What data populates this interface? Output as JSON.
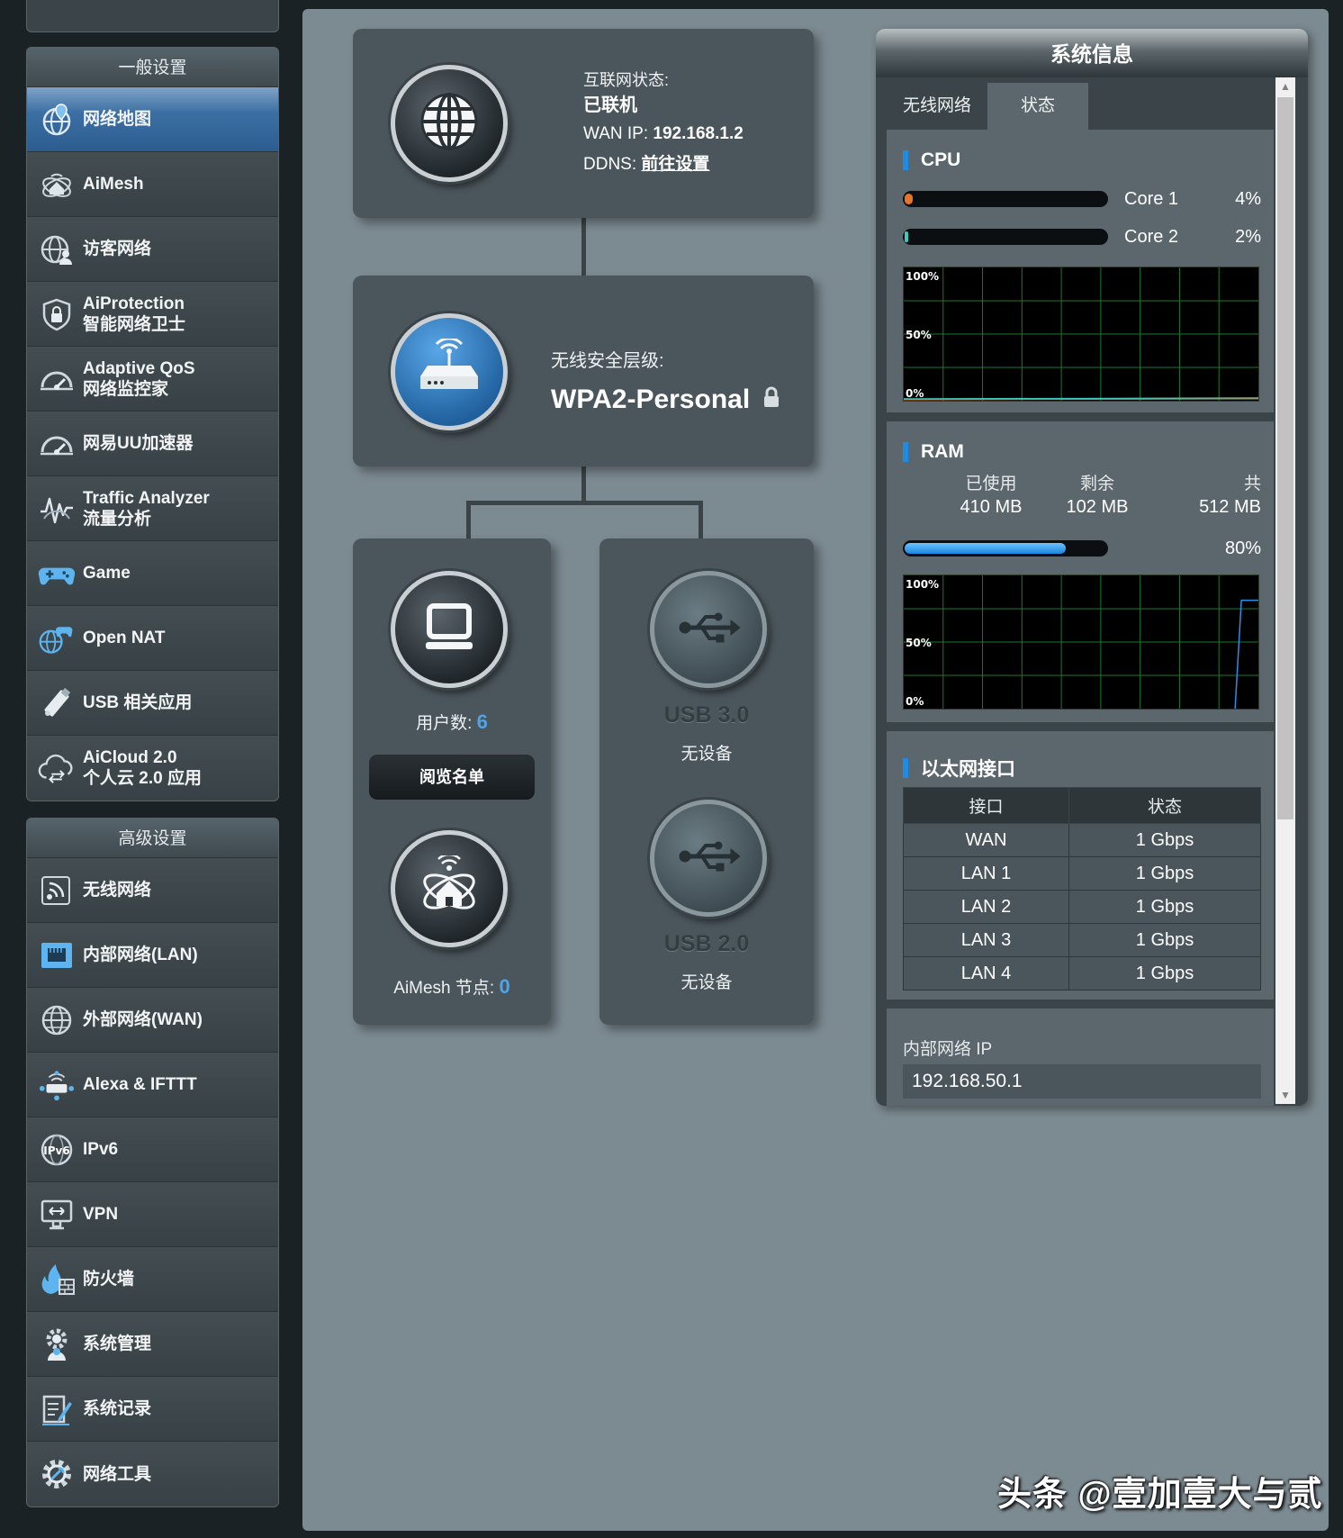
{
  "sidebar": {
    "general_header": "一般设置",
    "general_items": [
      {
        "label": "网络地图",
        "label2": "",
        "icon": "globe-map-icon",
        "active": true
      },
      {
        "label": "AiMesh",
        "label2": "",
        "icon": "aimesh-icon"
      },
      {
        "label": "访客网络",
        "label2": "",
        "icon": "guest-network-icon"
      },
      {
        "label": "AiProtection",
        "label2": "智能网络卫士",
        "icon": "shield-lock-icon"
      },
      {
        "label": "Adaptive QoS",
        "label2": "网络监控家",
        "icon": "speedometer-icon"
      },
      {
        "label": "网易UU加速器",
        "label2": "",
        "icon": "speedometer-icon"
      },
      {
        "label": "Traffic Analyzer",
        "label2": "流量分析",
        "icon": "traffic-wave-icon"
      },
      {
        "label": "Game",
        "label2": "",
        "icon": "gamepad-icon"
      },
      {
        "label": "Open NAT",
        "label2": "",
        "icon": "globe-gamepad-icon"
      },
      {
        "label": "USB 相关应用",
        "label2": "",
        "icon": "usb-pen-icon"
      },
      {
        "label": "AiCloud 2.0",
        "label2": "个人云 2.0 应用",
        "icon": "cloud-icon"
      }
    ],
    "advanced_header": "高级设置",
    "advanced_items": [
      {
        "label": "无线网络",
        "icon": "wireless-icon"
      },
      {
        "label": "内部网络(LAN)",
        "icon": "lan-port-icon"
      },
      {
        "label": "外部网络(WAN)",
        "icon": "globe-icon"
      },
      {
        "label": "Alexa & IFTTT",
        "icon": "alexa-router-icon"
      },
      {
        "label": "IPv6",
        "icon": "ipv6-icon"
      },
      {
        "label": "VPN",
        "icon": "vpn-monitor-icon"
      },
      {
        "label": "防火墙",
        "icon": "firewall-flame-icon"
      },
      {
        "label": "系统管理",
        "icon": "gear-person-icon"
      },
      {
        "label": "系统记录",
        "icon": "log-edit-icon"
      },
      {
        "label": "网络工具",
        "icon": "gear-tool-icon"
      }
    ]
  },
  "internet": {
    "status_label": "互联网状态:",
    "status_value": "已联机",
    "wan_ip_label": "WAN IP:",
    "wan_ip": "192.168.1.2",
    "ddns_label": "DDNS:",
    "ddns_link": "前往设置"
  },
  "security": {
    "label": "无线安全层级:",
    "value": "WPA2-Personal"
  },
  "clients": {
    "label": "用户数:",
    "count": "6",
    "button": "阅览名单"
  },
  "aimesh": {
    "label": "AiMesh 节点:",
    "count": "0"
  },
  "usb": [
    {
      "name": "USB 3.0",
      "status": "无设备"
    },
    {
      "name": "USB 2.0",
      "status": "无设备"
    }
  ],
  "sysinfo": {
    "title": "系统信息",
    "tabs": [
      "无线网络",
      "状态"
    ],
    "active_tab": 1,
    "cpu": {
      "heading": "CPU",
      "cores": [
        {
          "name": "Core 1",
          "value": "4%",
          "percent": 4,
          "color": "#e8742a"
        },
        {
          "name": "Core 2",
          "value": "2%",
          "percent": 2,
          "color": "#3ec9c0"
        }
      ],
      "graph_labels": [
        "100%",
        "50%",
        "0%"
      ]
    },
    "ram": {
      "heading": "RAM",
      "used_label": "已使用",
      "used": "410 MB",
      "free_label": "剩余",
      "free": "102 MB",
      "total_label": "共",
      "total": "512 MB",
      "percent_text": "80%",
      "percent": 80,
      "graph_labels": [
        "100%",
        "50%",
        "0%"
      ]
    },
    "ethernet": {
      "heading": "以太网接口",
      "col_port": "接口",
      "col_status": "状态",
      "rows": [
        {
          "port": "WAN",
          "status": "1 Gbps"
        },
        {
          "port": "LAN 1",
          "status": "1 Gbps"
        },
        {
          "port": "LAN 2",
          "status": "1 Gbps"
        },
        {
          "port": "LAN 3",
          "status": "1 Gbps"
        },
        {
          "port": "LAN 4",
          "status": "1 Gbps"
        }
      ]
    },
    "lan_ip_label": "内部网络 IP",
    "lan_ip": "192.168.50.1"
  },
  "watermark": "头条 @壹加壹大与贰"
}
